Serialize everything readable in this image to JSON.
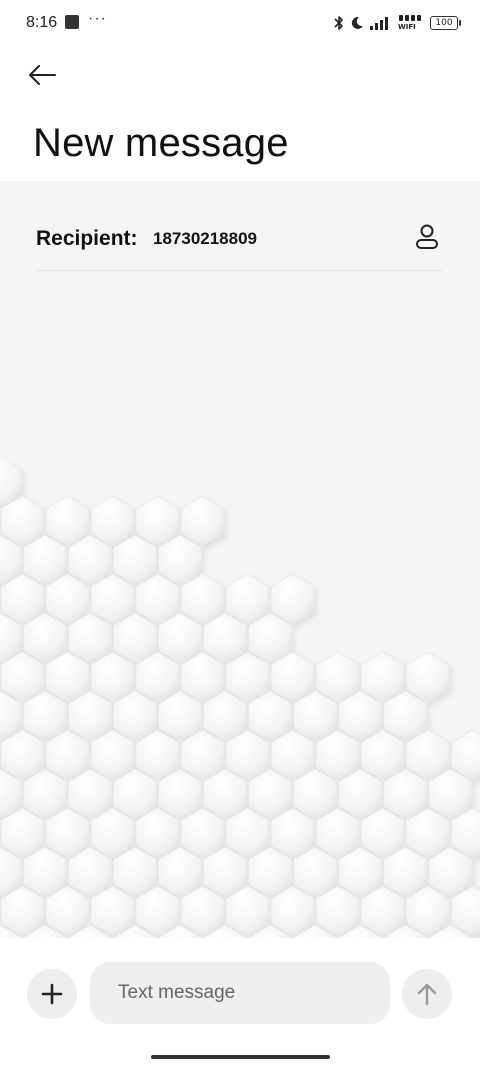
{
  "status_bar": {
    "time": "8:16",
    "overflow": "···",
    "wifi_label": "WIFI",
    "battery": "100",
    "icons": [
      "notification-square-icon",
      "bluetooth-icon",
      "moon-icon",
      "signal-icon",
      "wifi-icon",
      "battery-icon"
    ]
  },
  "header": {
    "back_icon": "arrow-left-icon",
    "title": "New message"
  },
  "recipient": {
    "label": "Recipient:",
    "number": "18730218809",
    "contact_icon": "person-icon"
  },
  "composer": {
    "add_icon": "plus-icon",
    "placeholder": "Text message",
    "send_icon": "arrow-up-icon"
  },
  "colors": {
    "background": "#f5f5f5",
    "surface": "#ffffff",
    "text": "#111111",
    "button_bg": "#eeeeee"
  }
}
